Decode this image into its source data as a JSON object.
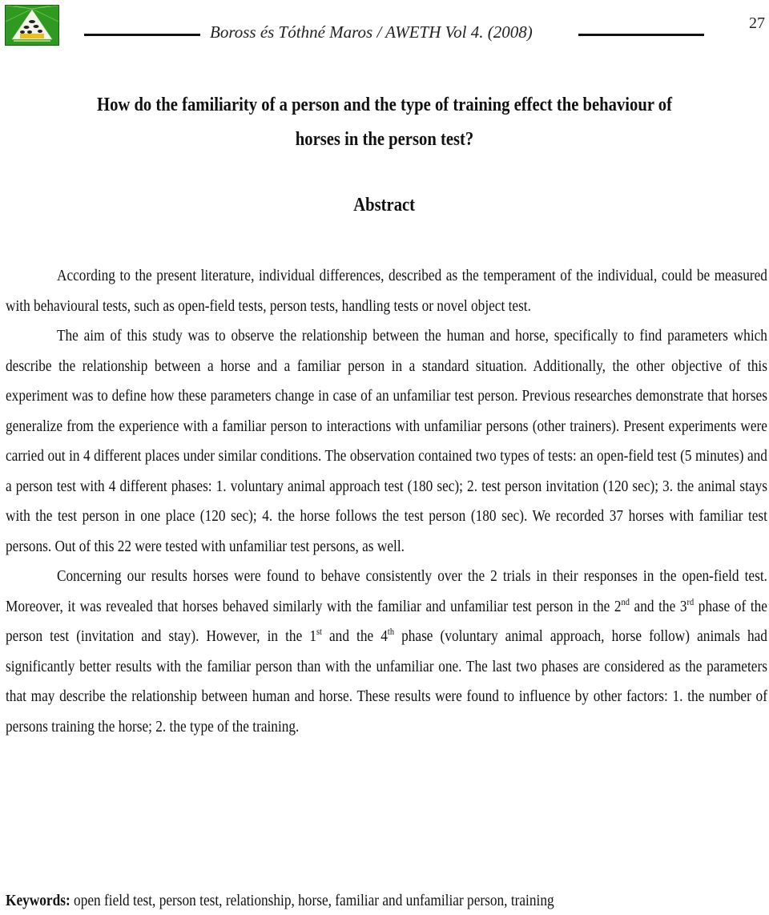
{
  "header": {
    "logo_icon": "aweth-journal-logo",
    "running_head": "Boross és Tóthné Maros / AWETH Vol 4. (2008)",
    "page_number": "27"
  },
  "title": {
    "line1": "How do the familiarity of a person and the type of training effect the behaviour of",
    "line2": "horses in the person test?"
  },
  "abstract": {
    "heading": "Abstract",
    "p1": "According to the present literature, individual differences, described as the temperament of the individual, could be measured with behavioural tests, such as open-field tests, person tests, handling tests or novel object test.",
    "p2": "The aim of this study was to observe the relationship between the human and horse, specifically to find parameters which describe the relationship between a horse and a familiar person in a standard situation. Additionally, the other objective of this experiment was to define how these parameters change in case of an unfamiliar test person. Previous researches demonstrate that horses generalize from the experience with a familiar person to interactions with unfamiliar persons (other trainers). Present experiments were carried out in 4 different places under similar conditions. The observation contained two types of tests: an open-field test (5 minutes) and a person test with 4 different phases: 1. voluntary animal approach test (180 sec); 2. test person invitation (120 sec); 3. the animal stays with the test person in one place (120 sec); 4. the horse follows the test person (180 sec). We recorded 37 horses with familiar test persons. Out of this 22 were tested with unfamiliar test persons, as well.",
    "p3": {
      "a": "Concerning our results horses were found to behave consistently over the 2 trials in their responses in the open-field test. Moreover, it was revealed that horses behaved similarly with the familiar and unfamiliar test person in the 2",
      "sup1": "nd",
      "b": " and the 3",
      "sup2": "rd",
      "c": " phase of the person test (invitation and stay). However, in the 1",
      "sup3": "st",
      "d": " and the 4",
      "sup4": "th",
      "e": " phase (voluntary animal approach, horse follow) animals had significantly better results with the familiar person than with the unfamiliar one. The last two phases are considered as the parameters that may describe the relationship between human and horse. These results were found to influence by other factors: 1. the number of persons training the horse; 2. the type of the training."
    }
  },
  "keywords": {
    "label": "Keywords:",
    "text": " open field test, person test, relationship, horse, familiar and unfamiliar person, training"
  }
}
